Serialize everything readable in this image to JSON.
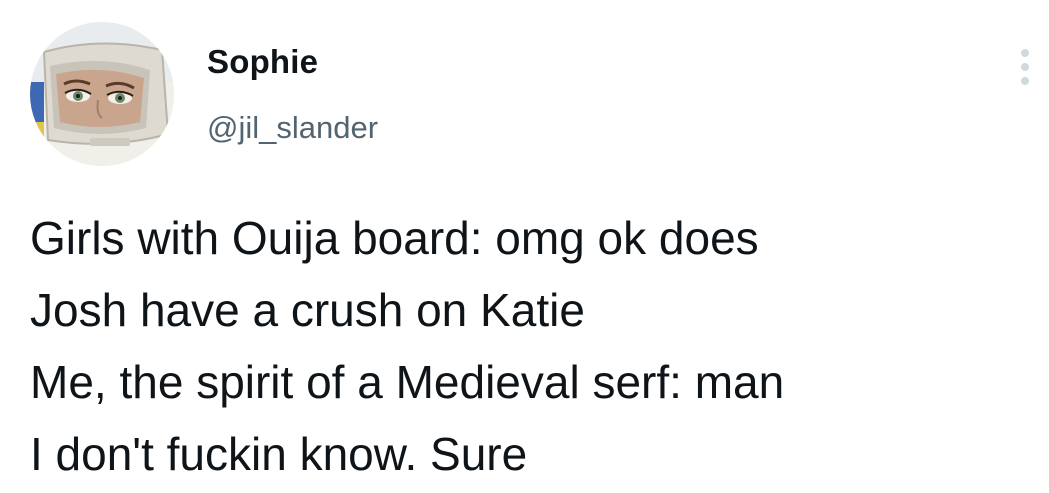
{
  "author": {
    "display_name": "Sophie",
    "handle": "@jil_slander",
    "avatar_icon": "avatar-image-crt-monitor-eyes"
  },
  "menu": {
    "icon": "more-vertical-icon"
  },
  "tweet": {
    "lines": [
      "Girls with Ouija board: omg ok does",
      "Josh have a crush on Katie",
      "Me, the spirit of a Medieval serf: man",
      "I don't fuckin know. Sure"
    ]
  },
  "colors": {
    "text_primary": "#0f1419",
    "text_secondary": "#536471",
    "menu_dots": "#cfd9de",
    "background": "#ffffff"
  }
}
